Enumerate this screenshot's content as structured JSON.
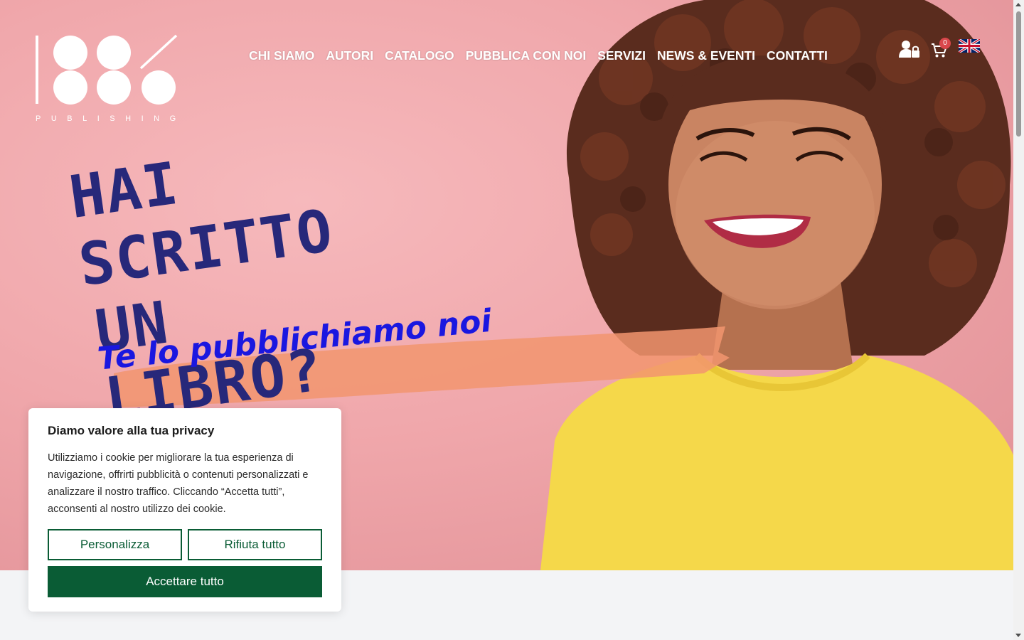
{
  "header": {
    "logo_text": "PUBLISHING",
    "nav": [
      "CHI SIAMO",
      "AUTORI",
      "CATALOGO",
      "PUBBLICA CON NOI",
      "SERVIZI",
      "NEWS & EVENTI",
      "CONTATTI"
    ],
    "cart_count": "0",
    "icons": [
      "user-lock-icon",
      "cart-icon",
      "uk-flag-icon"
    ]
  },
  "hero": {
    "headline_line1": "HAI SCRITTO",
    "headline_line2": "UN LIBRO?",
    "tagline": "Te lo pubblichiamo noi",
    "colors": {
      "headline": "#27287a",
      "tagline": "#1a17e0",
      "brush": "#f2956e",
      "shirt": "#f5d84a"
    }
  },
  "cookie_banner": {
    "title": "Diamo valore alla tua privacy",
    "text": "Utilizziamo i cookie per migliorare la tua esperienza di navigazione, offrirti pubblicità o contenuti personalizzati e analizzare il nostro traffico. Cliccando “Accetta tutti”, acconsenti al nostro utilizzo dei cookie.",
    "customize_label": "Personalizza",
    "reject_label": "Rifiuta tutto",
    "accept_label": "Accettare tutto",
    "accent": "#0a5c35"
  }
}
